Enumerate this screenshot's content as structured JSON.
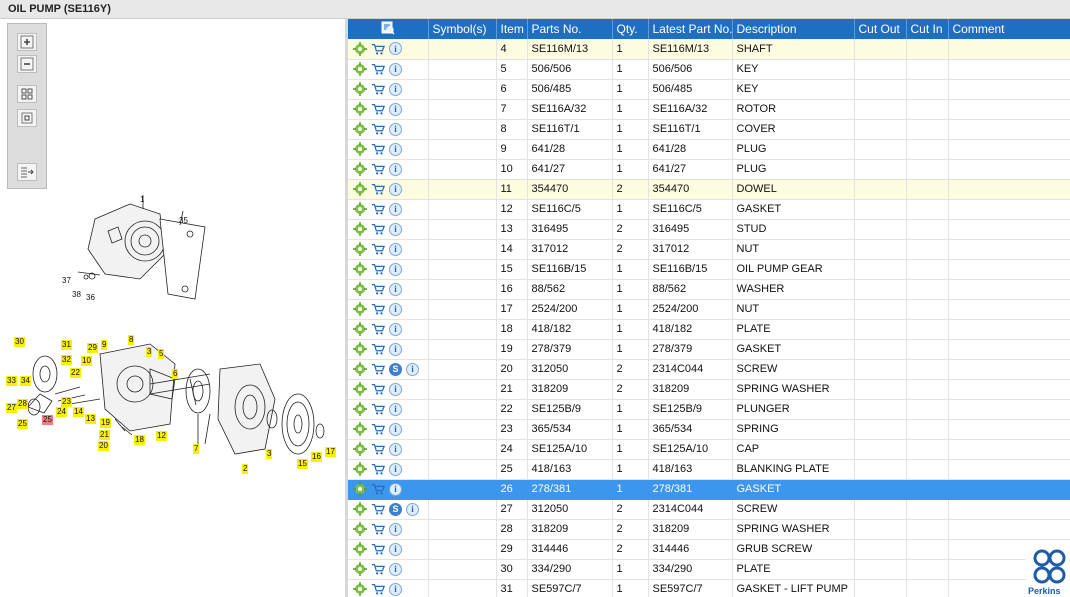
{
  "window": {
    "title": "OIL PUMP (SE116Y)"
  },
  "toolbar": {
    "zoom_in_icon": "plus-icon",
    "zoom_out_icon": "minus-icon",
    "fit_icon": "grid-icon",
    "actual_size_icon": "square-icon",
    "export_icon": "list-arrow-icon"
  },
  "drawing": {
    "callouts": [
      {
        "label": "1",
        "style": "plain"
      },
      {
        "label": "35",
        "style": "plain"
      },
      {
        "label": "37",
        "style": "plain"
      },
      {
        "label": "38",
        "style": "plain"
      },
      {
        "label": "36",
        "style": "plain"
      },
      {
        "label": "30",
        "style": "yel"
      },
      {
        "label": "31",
        "style": "yel"
      },
      {
        "label": "32",
        "style": "yel"
      },
      {
        "label": "33",
        "style": "yel"
      },
      {
        "label": "34",
        "style": "yel"
      },
      {
        "label": "29",
        "style": "yel"
      },
      {
        "label": "9",
        "style": "yel"
      },
      {
        "label": "8",
        "style": "yel"
      },
      {
        "label": "10",
        "style": "yel"
      },
      {
        "label": "3",
        "style": "yel"
      },
      {
        "label": "5",
        "style": "yel"
      },
      {
        "label": "22",
        "style": "yel"
      },
      {
        "label": "6",
        "style": "yel"
      },
      {
        "label": "23",
        "style": "yel"
      },
      {
        "label": "27",
        "style": "yel"
      },
      {
        "label": "28",
        "style": "yel"
      },
      {
        "label": "24",
        "style": "yel"
      },
      {
        "label": "14",
        "style": "yel"
      },
      {
        "label": "13",
        "style": "yel"
      },
      {
        "label": "25",
        "style": "yel"
      },
      {
        "label": "25",
        "style": "red"
      },
      {
        "label": "19",
        "style": "yel"
      },
      {
        "label": "21",
        "style": "yel"
      },
      {
        "label": "18",
        "style": "yel"
      },
      {
        "label": "12",
        "style": "yel"
      },
      {
        "label": "20",
        "style": "yel"
      },
      {
        "label": "7",
        "style": "yel"
      },
      {
        "label": "3",
        "style": "yel"
      },
      {
        "label": "2",
        "style": "yel"
      },
      {
        "label": "16",
        "style": "yel"
      },
      {
        "label": "17",
        "style": "yel"
      },
      {
        "label": "15",
        "style": "yel"
      }
    ]
  },
  "table": {
    "header_icon": "search-list-icon",
    "columns": [
      "Symbol(s)",
      "Item",
      "Parts No.",
      "Qty.",
      "Latest Part No.",
      "Description",
      "Cut Out",
      "Cut In",
      "Comment"
    ],
    "rows": [
      {
        "item": "4",
        "part": "SE116M/13",
        "qty": "1",
        "latest": "SE116M/13",
        "desc": "SHAFT",
        "state": "yl",
        "s": false
      },
      {
        "item": "5",
        "part": "506/506",
        "qty": "1",
        "latest": "506/506",
        "desc": "KEY",
        "state": "",
        "s": false
      },
      {
        "item": "6",
        "part": "506/485",
        "qty": "1",
        "latest": "506/485",
        "desc": "KEY",
        "state": "",
        "s": false
      },
      {
        "item": "7",
        "part": "SE116A/32",
        "qty": "1",
        "latest": "SE116A/32",
        "desc": "ROTOR",
        "state": "",
        "s": false
      },
      {
        "item": "8",
        "part": "SE116T/1",
        "qty": "1",
        "latest": "SE116T/1",
        "desc": "COVER",
        "state": "",
        "s": false
      },
      {
        "item": "9",
        "part": "641/28",
        "qty": "1",
        "latest": "641/28",
        "desc": "PLUG",
        "state": "",
        "s": false
      },
      {
        "item": "10",
        "part": "641/27",
        "qty": "1",
        "latest": "641/27",
        "desc": "PLUG",
        "state": "",
        "s": false
      },
      {
        "item": "11",
        "part": "354470",
        "qty": "2",
        "latest": "354470",
        "desc": "DOWEL",
        "state": "yl",
        "s": false
      },
      {
        "item": "12",
        "part": "SE116C/5",
        "qty": "1",
        "latest": "SE116C/5",
        "desc": "GASKET",
        "state": "",
        "s": false
      },
      {
        "item": "13",
        "part": "316495",
        "qty": "2",
        "latest": "316495",
        "desc": "STUD",
        "state": "",
        "s": false
      },
      {
        "item": "14",
        "part": "317012",
        "qty": "2",
        "latest": "317012",
        "desc": "NUT",
        "state": "",
        "s": false
      },
      {
        "item": "15",
        "part": "SE116B/15",
        "qty": "1",
        "latest": "SE116B/15",
        "desc": "OIL PUMP GEAR",
        "state": "",
        "s": false
      },
      {
        "item": "16",
        "part": "88/562",
        "qty": "1",
        "latest": "88/562",
        "desc": "WASHER",
        "state": "",
        "s": false
      },
      {
        "item": "17",
        "part": "2524/200",
        "qty": "1",
        "latest": "2524/200",
        "desc": "NUT",
        "state": "",
        "s": false
      },
      {
        "item": "18",
        "part": "418/182",
        "qty": "1",
        "latest": "418/182",
        "desc": "PLATE",
        "state": "",
        "s": false
      },
      {
        "item": "19",
        "part": "278/379",
        "qty": "1",
        "latest": "278/379",
        "desc": "GASKET",
        "state": "",
        "s": false
      },
      {
        "item": "20",
        "part": "312050",
        "qty": "2",
        "latest": "2314C044",
        "desc": "SCREW",
        "state": "",
        "s": true
      },
      {
        "item": "21",
        "part": "318209",
        "qty": "2",
        "latest": "318209",
        "desc": "SPRING WASHER",
        "state": "",
        "s": false
      },
      {
        "item": "22",
        "part": "SE125B/9",
        "qty": "1",
        "latest": "SE125B/9",
        "desc": "PLUNGER",
        "state": "",
        "s": false
      },
      {
        "item": "23",
        "part": "365/534",
        "qty": "1",
        "latest": "365/534",
        "desc": "SPRING",
        "state": "",
        "s": false
      },
      {
        "item": "24",
        "part": "SE125A/10",
        "qty": "1",
        "latest": "SE125A/10",
        "desc": "CAP",
        "state": "",
        "s": false
      },
      {
        "item": "25",
        "part": "418/163",
        "qty": "1",
        "latest": "418/163",
        "desc": "BLANKING PLATE",
        "state": "",
        "s": false
      },
      {
        "item": "26",
        "part": "278/381",
        "qty": "1",
        "latest": "278/381",
        "desc": "GASKET",
        "state": "sel",
        "s": false
      },
      {
        "item": "27",
        "part": "312050",
        "qty": "2",
        "latest": "2314C044",
        "desc": "SCREW",
        "state": "",
        "s": true
      },
      {
        "item": "28",
        "part": "318209",
        "qty": "2",
        "latest": "318209",
        "desc": "SPRING WASHER",
        "state": "",
        "s": false
      },
      {
        "item": "29",
        "part": "314446",
        "qty": "2",
        "latest": "314446",
        "desc": "GRUB SCREW",
        "state": "",
        "s": false
      },
      {
        "item": "30",
        "part": "334/290",
        "qty": "1",
        "latest": "334/290",
        "desc": "PLATE",
        "state": "",
        "s": false
      },
      {
        "item": "31",
        "part": "SE597C/7",
        "qty": "1",
        "latest": "SE597C/7",
        "desc": "GASKET - LIFT PUMP",
        "state": "",
        "s": false
      }
    ]
  },
  "brand": {
    "name": "Perkins",
    "color": "#1e5ca8"
  },
  "colors": {
    "header": "#1d6fc4",
    "selected": "#3d96ee",
    "highlight": "#fdfbe0",
    "callout": "#f8f000",
    "callout_red": "#f47c7c"
  }
}
